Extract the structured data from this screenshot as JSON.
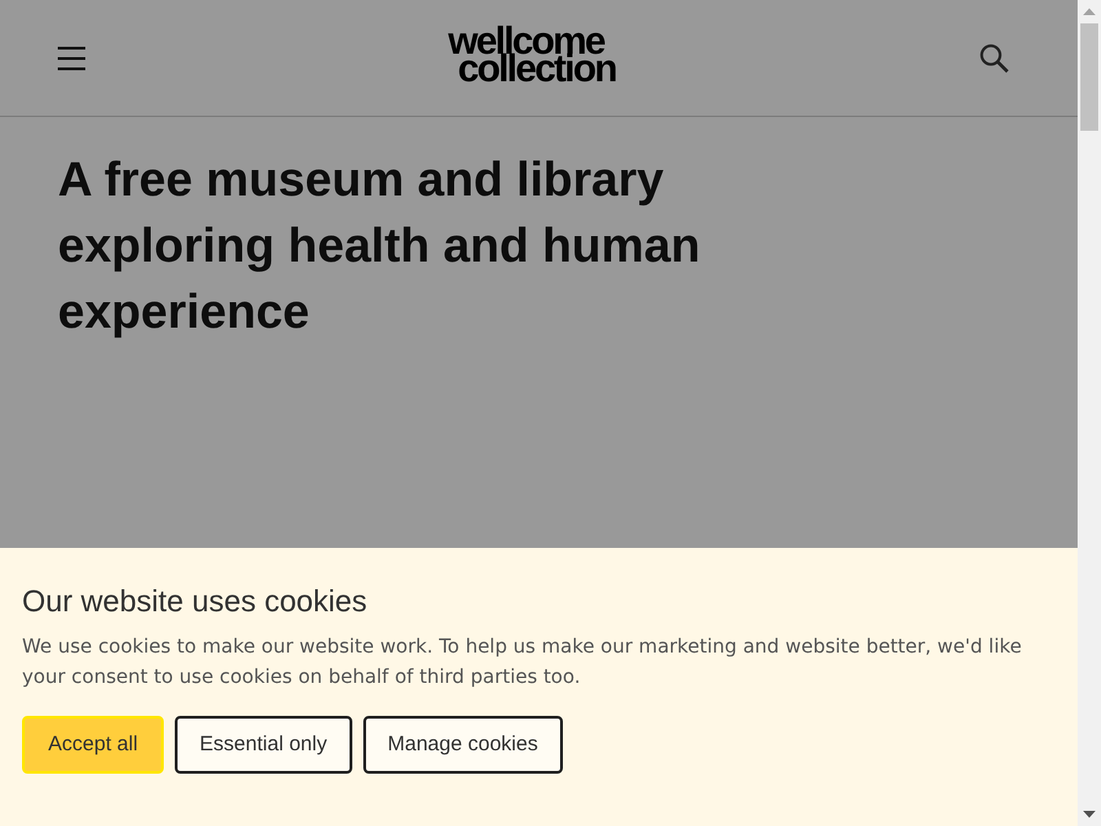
{
  "header": {
    "logo": [
      "wellcome",
      "collection"
    ]
  },
  "hero": {
    "title": "A free museum and library exploring health and human experience"
  },
  "cookie_banner": {
    "title": "Our website uses cookies",
    "text": "We use cookies to make our website work. To help us make our marketing and website better, we'd like your consent to use cookies on behalf of third parties too.",
    "buttons": [
      {
        "label": "Accept all",
        "kind": "primary"
      },
      {
        "label": "Essential only",
        "kind": "secondary"
      },
      {
        "label": "Manage cookies",
        "kind": "secondary"
      }
    ]
  }
}
